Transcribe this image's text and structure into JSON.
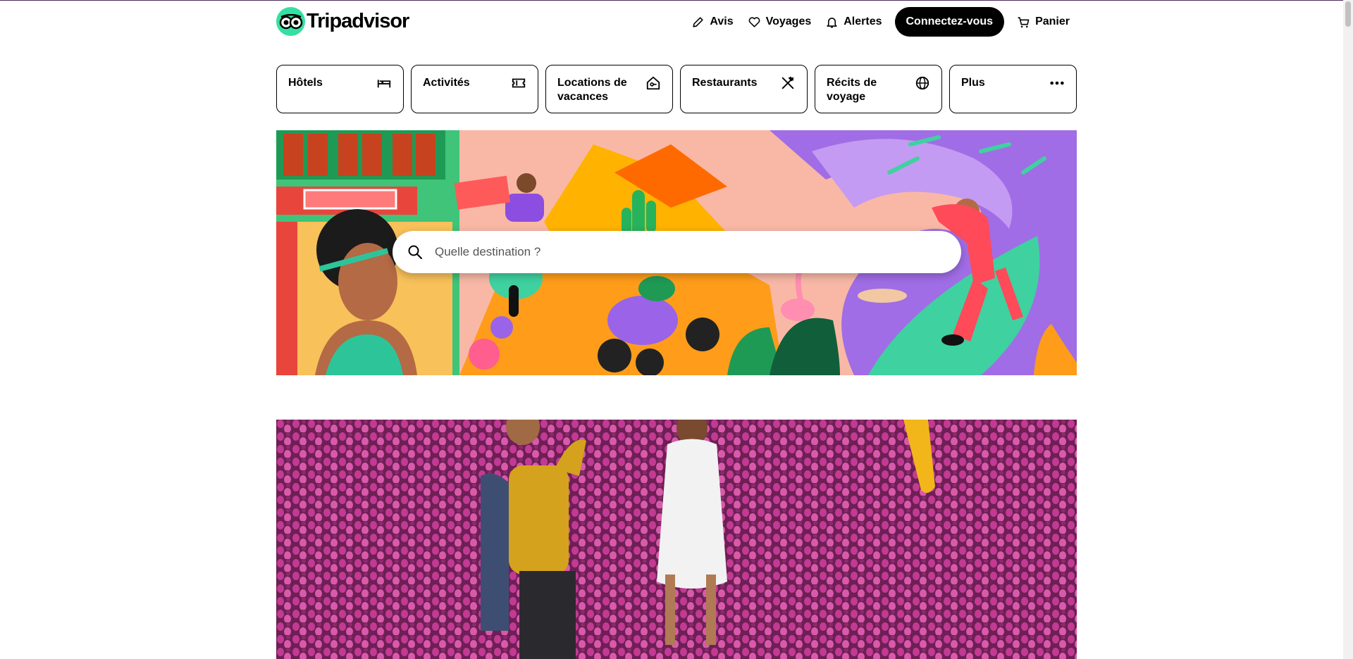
{
  "brand": {
    "name": "Tripadvisor"
  },
  "header": {
    "nav": [
      {
        "label": "Avis",
        "icon": "pencil-icon"
      },
      {
        "label": "Voyages",
        "icon": "heart-icon"
      },
      {
        "label": "Alertes",
        "icon": "bell-icon"
      }
    ],
    "login_label": "Connectez-vous",
    "cart_label": "Panier"
  },
  "categories": [
    {
      "label": "Hôtels",
      "icon": "bed-icon"
    },
    {
      "label": "Activités",
      "icon": "ticket-icon"
    },
    {
      "label": "Locations de vacances",
      "icon": "house-key-icon"
    },
    {
      "label": "Restaurants",
      "icon": "utensils-icon"
    },
    {
      "label": "Récits de voyage",
      "icon": "globe-icon"
    },
    {
      "label": "Plus",
      "icon": "more-dots-icon"
    }
  ],
  "search": {
    "placeholder": "Quelle destination ?"
  },
  "feature": {
    "title": ""
  },
  "colors": {
    "brand_green": "#34e0a1",
    "accent_black": "#000000",
    "top_border": "#4b2a5a"
  }
}
